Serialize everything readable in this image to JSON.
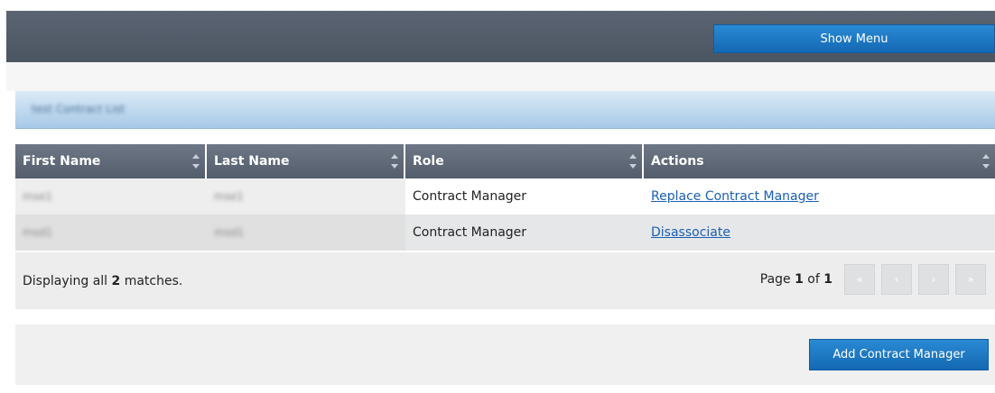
{
  "header": {
    "show_menu_label": "Show Menu"
  },
  "section": {
    "title": "test Contract List"
  },
  "table": {
    "columns": [
      "First Name",
      "Last Name",
      "Role",
      "Actions"
    ],
    "rows": [
      {
        "first_name": "mse1",
        "last_name": "mse1",
        "role": "Contract Manager",
        "action": "Replace Contract Manager"
      },
      {
        "first_name": "msd1",
        "last_name": "msd1",
        "role": "Contract Manager",
        "action": "Disassociate"
      }
    ]
  },
  "footer": {
    "display_prefix": "Displaying all ",
    "count": "2",
    "display_suffix": " matches.",
    "page_prefix": "Page ",
    "page_current": "1",
    "page_of": " of ",
    "page_total": "1",
    "pager_buttons": [
      "«",
      "‹",
      "›",
      "»"
    ]
  },
  "actions": {
    "add_label": "Add Contract Manager"
  }
}
